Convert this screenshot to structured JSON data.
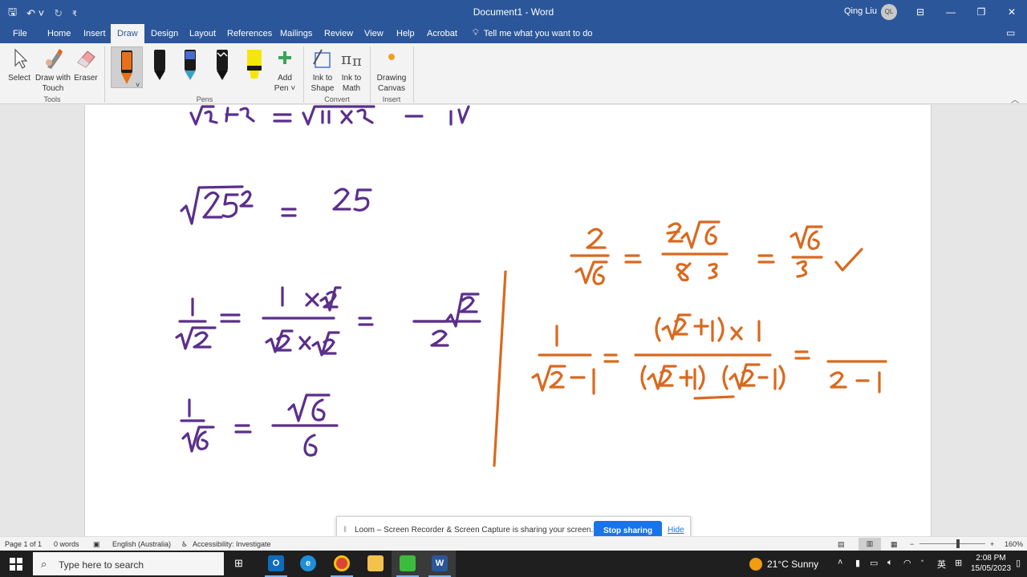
{
  "window": {
    "title": "Document1 - Word",
    "user": "Qing Liu",
    "user_initials": "QL"
  },
  "tabs": [
    {
      "label": "File"
    },
    {
      "label": "Home"
    },
    {
      "label": "Insert"
    },
    {
      "label": "Draw"
    },
    {
      "label": "Design"
    },
    {
      "label": "Layout"
    },
    {
      "label": "References"
    },
    {
      "label": "Mailings"
    },
    {
      "label": "Review"
    },
    {
      "label": "View"
    },
    {
      "label": "Help"
    },
    {
      "label": "Acrobat"
    }
  ],
  "active_tab": "Draw",
  "tell_me": "Tell me what you want to do",
  "ribbon": {
    "tools": {
      "select": "Select",
      "draw_touch_1": "Draw with",
      "draw_touch_2": "Touch",
      "eraser": "Eraser",
      "group": "Tools"
    },
    "pens": {
      "add_pen_1": "Add",
      "add_pen_2": "Pen ˅",
      "group": "Pens"
    },
    "convert": {
      "ink_shape_1": "Ink to",
      "ink_shape_2": "Shape",
      "ink_math_1": "Ink to",
      "ink_math_2": "Math",
      "group": "Convert"
    },
    "insert": {
      "canvas_1": "Drawing",
      "canvas_2": "Canvas",
      "group": "Insert"
    }
  },
  "colors": {
    "word_blue": "#2b579a",
    "ink_purple": "#5b2f8c",
    "ink_orange": "#d9691f",
    "stop_button": "#1a73e8"
  },
  "banner": {
    "message": "Loom – Screen Recorder & Screen Capture is sharing your screen.",
    "stop": "Stop sharing",
    "hide": "Hide"
  },
  "status": {
    "page": "Page 1 of 1",
    "words": "0 words",
    "language": "English (Australia)",
    "accessibility": "Accessibility: Investigate",
    "zoom": "160%"
  },
  "taskbar": {
    "search_placeholder": "Type here to search",
    "weather": "21°C  Sunny",
    "time": "2:08 PM",
    "date": "15/05/2023",
    "ime": "英"
  }
}
